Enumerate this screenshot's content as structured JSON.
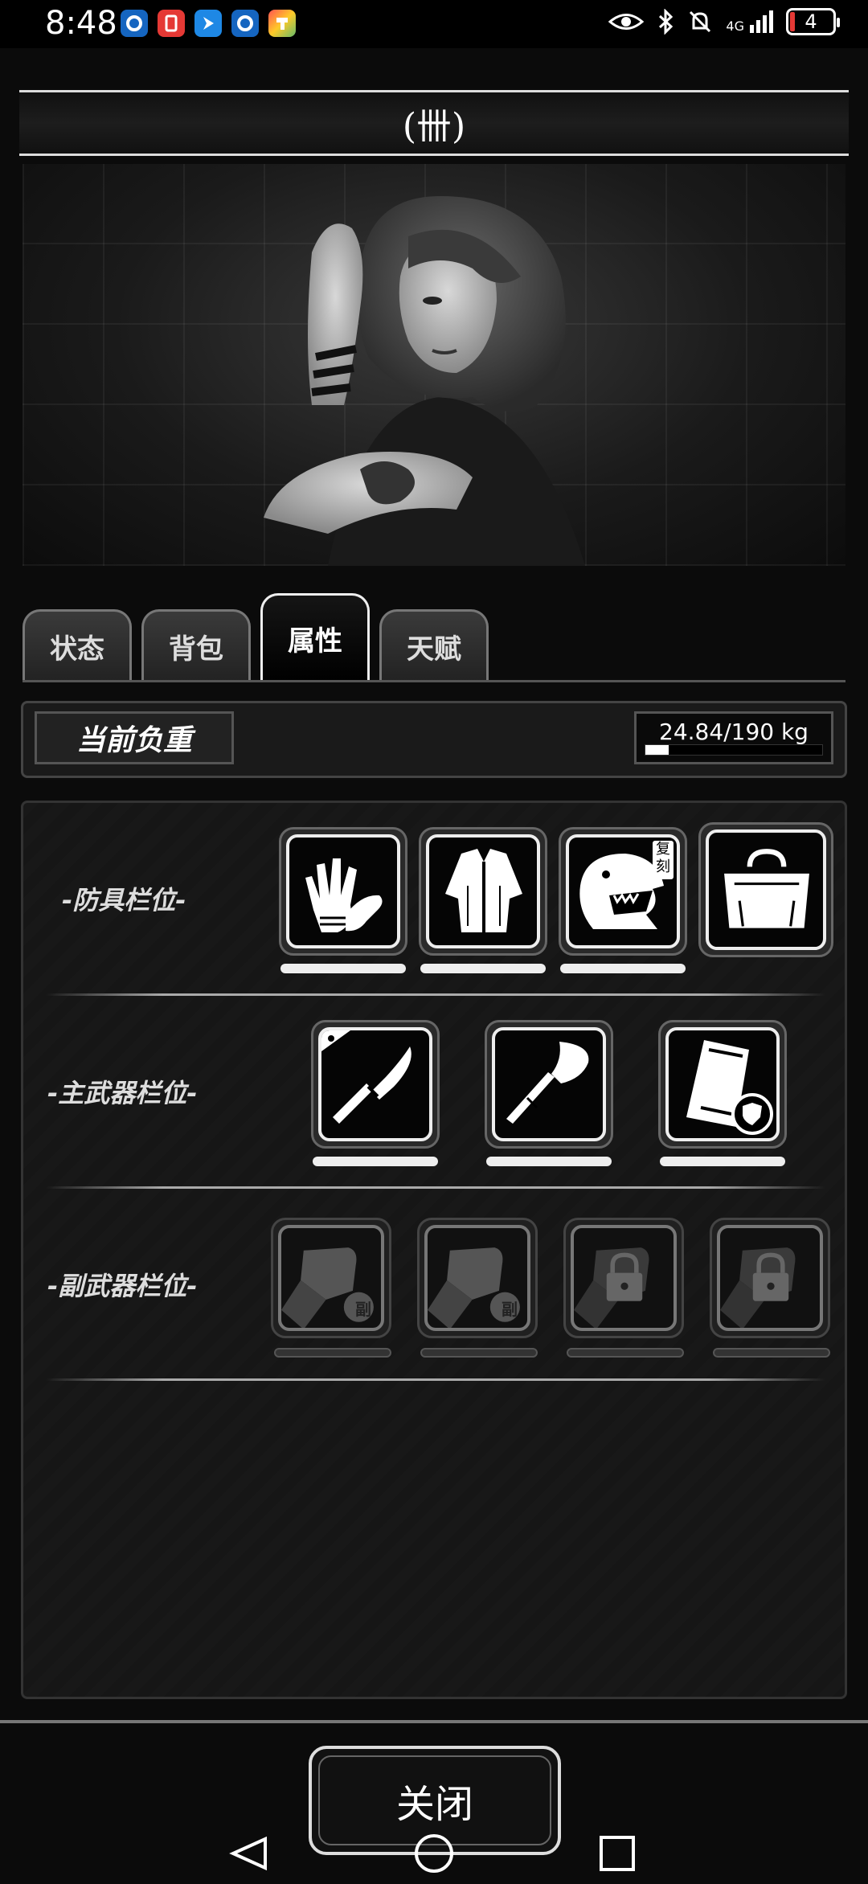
{
  "status_bar": {
    "time": "8:48",
    "network": "4G",
    "battery": "4",
    "icons": [
      "app-blue-icon",
      "app-red-icon",
      "app-arrow-icon",
      "app-blue2-icon",
      "app-color-icon",
      "eye-icon",
      "bluetooth-icon",
      "mute-icon",
      "signal-icon"
    ]
  },
  "character": {
    "name": "(卌)"
  },
  "tabs": [
    {
      "label": "状态",
      "active": false
    },
    {
      "label": "背包",
      "active": false
    },
    {
      "label": "属性",
      "active": true
    },
    {
      "label": "天赋",
      "active": false
    }
  ],
  "weight": {
    "label": "当前负重",
    "value": "24.84/190 kg",
    "fraction": 0.13
  },
  "slots": {
    "armor": {
      "label": "-防具栏位-",
      "items": [
        "gloves-icon",
        "jacket-icon",
        "dino-mask-icon",
        "bag-icon"
      ],
      "mask_tag": "复刻"
    },
    "main_weapon": {
      "label": "-主武器栏位-",
      "items": [
        "knife-icon",
        "axe-icon",
        "shield-case-icon"
      ]
    },
    "sub_weapon": {
      "label": "-副武器栏位-",
      "items": [
        "fist-sub-icon",
        "fist-sub-icon",
        "fist-lock-icon",
        "fist-lock-icon"
      ],
      "sub_tag": "副"
    }
  },
  "close_button": "关闭",
  "colors": {
    "accent": "#ffffff",
    "panel": "#181818",
    "battery_low": "#e53935"
  }
}
